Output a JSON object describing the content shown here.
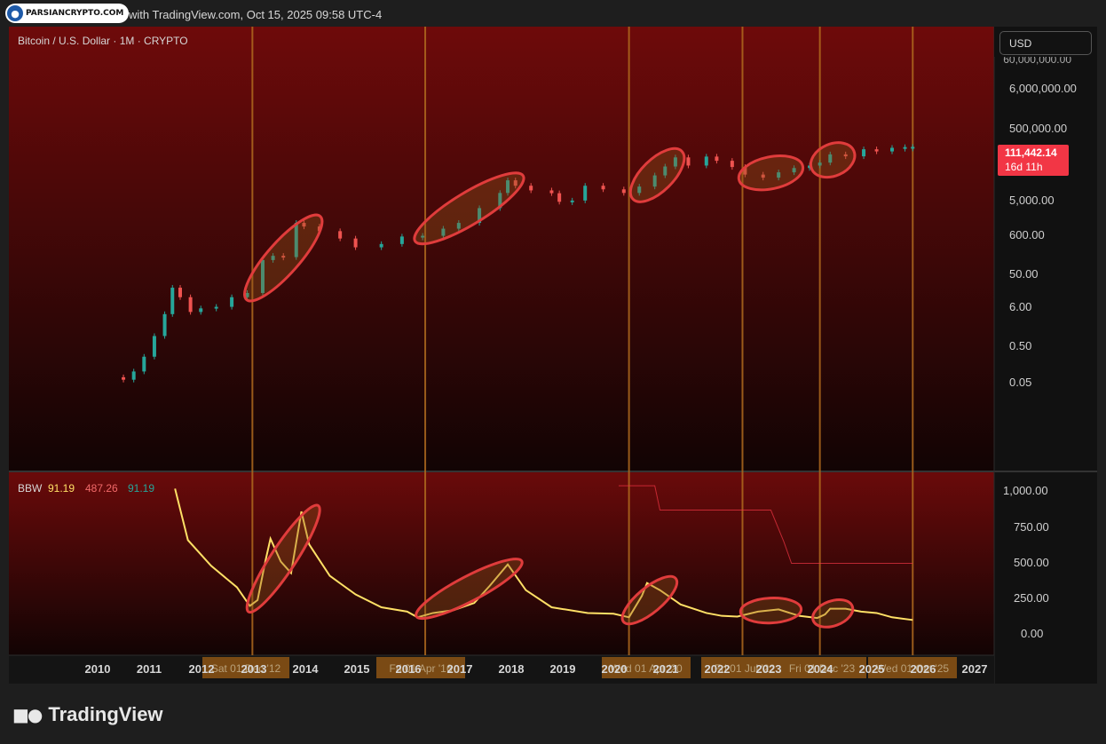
{
  "watermark": {
    "badge_text": "PARSIANCRYPTO.COM",
    "icon": "person-icon"
  },
  "header": {
    "caption": "with TradingView.com, Oct 15, 2025 09:58 UTC-4"
  },
  "symbol": {
    "title": "Bitcoin / U.S. Dollar · 1M · CRYPTO"
  },
  "currency_button": {
    "label": "USD"
  },
  "price_axis": {
    "ticks": [
      "6,000,000.00",
      "500,000.00",
      "5,000.00",
      "600.00",
      "50.00",
      "6.00",
      "0.50",
      "0.05"
    ],
    "clipped_top_tick": "60,000,000.00"
  },
  "last_price": {
    "value": "111,442.14",
    "countdown": "16d 11h",
    "color": "#f23645"
  },
  "indicator": {
    "name": "BBW",
    "value_main": "91.19",
    "value_upper": "487.26",
    "value_lower": "91.19",
    "ticks": [
      "1,000.00",
      "750.00",
      "500.00",
      "250.00",
      "0.00"
    ],
    "line_color": "#ffe066",
    "expansion_color": "#f23645"
  },
  "time_axis": {
    "years": [
      "2010",
      "2011",
      "2012",
      "2013",
      "2014",
      "2015",
      "2016",
      "2017",
      "2018",
      "2019",
      "2020",
      "2021",
      "2022",
      "2023",
      "2024",
      "2025",
      "2026",
      "2027"
    ],
    "range_labels": [
      {
        "text": "Sat 01 Dec '12"
      },
      {
        "text": "Fri 01 Apr '16"
      },
      {
        "text": "Wed 01 Apr '20"
      },
      {
        "text": "Fri 01 Jul '22"
      },
      {
        "text": "Fri 01 Dec '23"
      },
      {
        "text": "Wed 01 Oct '25"
      }
    ]
  },
  "colors": {
    "up": "#26a69a",
    "down": "#ef5350",
    "marker": "#b06a1e",
    "highlight": "#e03c3c"
  },
  "chart_data": {
    "type": "candlestick",
    "title": "Bitcoin / U.S. Dollar · 1M · CRYPTO",
    "y_scale": "log",
    "price_series": [
      {
        "x": 2010.5,
        "o": 0.07,
        "c": 0.06
      },
      {
        "x": 2010.7,
        "o": 0.06,
        "c": 0.1
      },
      {
        "x": 2010.9,
        "o": 0.1,
        "c": 0.25
      },
      {
        "x": 2011.1,
        "o": 0.25,
        "c": 0.9
      },
      {
        "x": 2011.3,
        "o": 0.9,
        "c": 3.5
      },
      {
        "x": 2011.45,
        "o": 3.5,
        "c": 18
      },
      {
        "x": 2011.6,
        "o": 18,
        "c": 10
      },
      {
        "x": 2011.8,
        "o": 10,
        "c": 4
      },
      {
        "x": 2012.0,
        "o": 4,
        "c": 5
      },
      {
        "x": 2012.3,
        "o": 5,
        "c": 5.5
      },
      {
        "x": 2012.6,
        "o": 5.5,
        "c": 10
      },
      {
        "x": 2012.9,
        "o": 10,
        "c": 13
      },
      {
        "x": 2013.2,
        "o": 13,
        "c": 100
      },
      {
        "x": 2013.4,
        "o": 100,
        "c": 130
      },
      {
        "x": 2013.6,
        "o": 130,
        "c": 120
      },
      {
        "x": 2013.85,
        "o": 120,
        "c": 1000
      },
      {
        "x": 2014.0,
        "o": 1000,
        "c": 800
      },
      {
        "x": 2014.3,
        "o": 800,
        "c": 600
      },
      {
        "x": 2014.7,
        "o": 600,
        "c": 380
      },
      {
        "x": 2015.0,
        "o": 380,
        "c": 220
      },
      {
        "x": 2015.5,
        "o": 220,
        "c": 270
      },
      {
        "x": 2015.9,
        "o": 270,
        "c": 430
      },
      {
        "x": 2016.3,
        "o": 430,
        "c": 450
      },
      {
        "x": 2016.7,
        "o": 450,
        "c": 700
      },
      {
        "x": 2017.0,
        "o": 700,
        "c": 1000
      },
      {
        "x": 2017.4,
        "o": 1000,
        "c": 2500
      },
      {
        "x": 2017.8,
        "o": 2500,
        "c": 6400
      },
      {
        "x": 2017.95,
        "o": 6400,
        "c": 14000
      },
      {
        "x": 2018.1,
        "o": 14000,
        "c": 10000
      },
      {
        "x": 2018.4,
        "o": 10000,
        "c": 7500
      },
      {
        "x": 2018.8,
        "o": 7500,
        "c": 6300
      },
      {
        "x": 2018.95,
        "o": 6300,
        "c": 3700
      },
      {
        "x": 2019.2,
        "o": 3700,
        "c": 4000
      },
      {
        "x": 2019.45,
        "o": 4000,
        "c": 10000
      },
      {
        "x": 2019.8,
        "o": 10000,
        "c": 8000
      },
      {
        "x": 2020.2,
        "o": 8000,
        "c": 6400
      },
      {
        "x": 2020.5,
        "o": 6400,
        "c": 9500
      },
      {
        "x": 2020.8,
        "o": 9500,
        "c": 19000
      },
      {
        "x": 2021.0,
        "o": 19000,
        "c": 33000
      },
      {
        "x": 2021.2,
        "o": 33000,
        "c": 58000
      },
      {
        "x": 2021.45,
        "o": 58000,
        "c": 35000
      },
      {
        "x": 2021.8,
        "o": 35000,
        "c": 61000
      },
      {
        "x": 2022.0,
        "o": 61000,
        "c": 47000
      },
      {
        "x": 2022.3,
        "o": 47000,
        "c": 32000
      },
      {
        "x": 2022.55,
        "o": 32000,
        "c": 20000
      },
      {
        "x": 2022.9,
        "o": 20000,
        "c": 16500
      },
      {
        "x": 2023.2,
        "o": 16500,
        "c": 23000
      },
      {
        "x": 2023.5,
        "o": 23000,
        "c": 30000
      },
      {
        "x": 2023.8,
        "o": 30000,
        "c": 35000
      },
      {
        "x": 2024.0,
        "o": 35000,
        "c": 42000
      },
      {
        "x": 2024.2,
        "o": 42000,
        "c": 70000
      },
      {
        "x": 2024.5,
        "o": 70000,
        "c": 62000
      },
      {
        "x": 2024.85,
        "o": 62000,
        "c": 96000
      },
      {
        "x": 2025.1,
        "o": 96000,
        "c": 84000
      },
      {
        "x": 2025.4,
        "o": 84000,
        "c": 105000
      },
      {
        "x": 2025.65,
        "o": 105000,
        "c": 110000
      },
      {
        "x": 2025.8,
        "o": 110000,
        "c": 111442.14
      }
    ],
    "bbw_series": [
      [
        2011.5,
        1010
      ],
      [
        2011.75,
        650
      ],
      [
        2012.2,
        470
      ],
      [
        2012.7,
        320
      ],
      [
        2012.95,
        190
      ],
      [
        2013.1,
        230
      ],
      [
        2013.25,
        500
      ],
      [
        2013.35,
        660
      ],
      [
        2013.55,
        500
      ],
      [
        2013.75,
        420
      ],
      [
        2013.95,
        850
      ],
      [
        2014.1,
        620
      ],
      [
        2014.5,
        400
      ],
      [
        2015.0,
        270
      ],
      [
        2015.5,
        180
      ],
      [
        2016.0,
        150
      ],
      [
        2016.2,
        110
      ],
      [
        2016.5,
        140
      ],
      [
        2016.9,
        160
      ],
      [
        2017.3,
        210
      ],
      [
        2017.6,
        330
      ],
      [
        2017.95,
        480
      ],
      [
        2018.3,
        300
      ],
      [
        2018.8,
        180
      ],
      [
        2019.5,
        140
      ],
      [
        2020.0,
        135
      ],
      [
        2020.3,
        110
      ],
      [
        2020.55,
        260
      ],
      [
        2020.65,
        350
      ],
      [
        2020.9,
        300
      ],
      [
        2021.3,
        200
      ],
      [
        2021.8,
        140
      ],
      [
        2022.1,
        120
      ],
      [
        2022.4,
        115
      ],
      [
        2022.8,
        150
      ],
      [
        2023.2,
        165
      ],
      [
        2023.6,
        120
      ],
      [
        2023.95,
        105
      ],
      [
        2024.1,
        130
      ],
      [
        2024.2,
        170
      ],
      [
        2024.5,
        170
      ],
      [
        2024.8,
        150
      ],
      [
        2025.1,
        140
      ],
      [
        2025.4,
        110
      ],
      [
        2025.8,
        91.19
      ]
    ],
    "bbw_expansion_series": [
      [
        2020.1,
        1030
      ],
      [
        2020.8,
        1030
      ],
      [
        2020.9,
        860
      ],
      [
        2023.05,
        860
      ],
      [
        2023.3,
        640
      ],
      [
        2023.45,
        487.26
      ],
      [
        2025.8,
        487.26
      ]
    ],
    "event_markers": [
      2013.0,
      2016.35,
      2020.3,
      2022.5,
      2024.0,
      2025.8
    ],
    "price_highlights": [
      [
        2013.0,
        2014.2
      ],
      [
        2016.3,
        2018.1
      ],
      [
        2020.5,
        2021.2
      ],
      [
        2022.6,
        2023.5
      ],
      [
        2024.0,
        2024.5
      ]
    ],
    "bbw_highlights": [
      [
        2013.0,
        2014.2
      ],
      [
        2016.3,
        2018.1
      ],
      [
        2020.3,
        2021.1
      ],
      [
        2022.6,
        2023.5
      ],
      [
        2024.0,
        2024.5
      ]
    ],
    "x_range": [
      2009.7,
      2027.4
    ],
    "bbw_ylim": [
      -50,
      1050
    ]
  }
}
